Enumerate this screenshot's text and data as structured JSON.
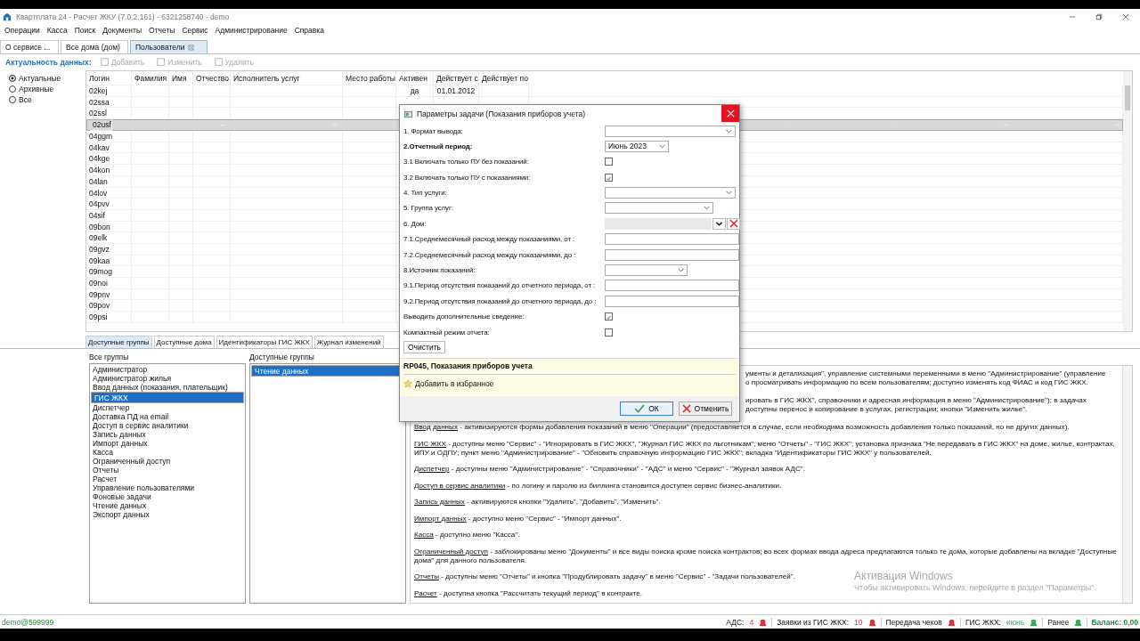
{
  "window": {
    "title": "Квартплата 24 - Расчет ЖКУ (7.0.2.161) - 6321258740 - demo"
  },
  "menu": [
    "Операции",
    "Касса",
    "Поиск",
    "Документы",
    "Отчеты",
    "Сервис",
    "Администрирование",
    "Справка"
  ],
  "tabs": [
    {
      "label": "О сервисе ...",
      "selected": false,
      "closable": false
    },
    {
      "label": "Все дома (дом)",
      "selected": false,
      "closable": false
    },
    {
      "label": "Пользователи",
      "selected": true,
      "closable": true
    }
  ],
  "toolbar": {
    "label": "Актуальность данных:",
    "buttons": [
      {
        "label": "Добавить",
        "disabled": true
      },
      {
        "label": "Изменить",
        "disabled": true
      },
      {
        "label": "Удалить",
        "disabled": true
      }
    ]
  },
  "filter": [
    {
      "label": "Актуальные",
      "selected": true
    },
    {
      "label": "Архивные",
      "selected": false
    },
    {
      "label": "Все",
      "selected": false
    }
  ],
  "table": {
    "columns": [
      "Логин",
      "Фамилия",
      "Имя",
      "Отчество",
      "Исполнитель услуг",
      "Место работы",
      "Активен",
      "Действует с",
      "Действует по"
    ],
    "rows": [
      {
        "login": "02kej",
        "active": "да",
        "from": "01.01.2012",
        "selected": false
      },
      {
        "login": "02ssa",
        "selected": false
      },
      {
        "login": "02ssl",
        "selected": false
      },
      {
        "login": "02usf",
        "selected": true
      },
      {
        "login": "04ggm",
        "selected": false
      },
      {
        "login": "04kav",
        "selected": false
      },
      {
        "login": "04kge",
        "selected": false
      },
      {
        "login": "04kon",
        "selected": false
      },
      {
        "login": "04lan",
        "selected": false
      },
      {
        "login": "04lov",
        "selected": false
      },
      {
        "login": "04pvv",
        "selected": false
      },
      {
        "login": "04sif",
        "selected": false
      },
      {
        "login": "09bon",
        "selected": false
      },
      {
        "login": "09elk",
        "selected": false
      },
      {
        "login": "09gvz",
        "selected": false
      },
      {
        "login": "09kaa",
        "selected": false
      },
      {
        "login": "09mog",
        "selected": false
      },
      {
        "login": "09noi",
        "selected": false
      },
      {
        "login": "09pnv",
        "selected": false
      },
      {
        "login": "09pov",
        "selected": false
      },
      {
        "login": "09psi",
        "selected": false
      }
    ]
  },
  "bottom_tabs": [
    {
      "label": "Доступные группы",
      "selected": true
    },
    {
      "label": "Доступные дома",
      "selected": false
    },
    {
      "label": "Идентификаторы ГИС ЖКХ",
      "selected": false
    },
    {
      "label": "Журнал изменений",
      "selected": false
    }
  ],
  "all_groups": {
    "title": "Все группы",
    "items": [
      {
        "label": "Администратор",
        "selected": false
      },
      {
        "label": "Администратор жилья",
        "selected": false
      },
      {
        "label": "Ввод данных (показания, плательщик)",
        "selected": false
      },
      {
        "label": "ГИС ЖКХ",
        "selected": true
      },
      {
        "label": "Диспетчер",
        "selected": false
      },
      {
        "label": "Доставка ПД на email",
        "selected": false
      },
      {
        "label": "Доступ в сервис аналитики",
        "selected": false
      },
      {
        "label": "Запись данных",
        "selected": false
      },
      {
        "label": "Импорт данных",
        "selected": false
      },
      {
        "label": "Касса",
        "selected": false
      },
      {
        "label": "Ограниченный доступ",
        "selected": false
      },
      {
        "label": "Отчеты",
        "selected": false
      },
      {
        "label": "Расчет",
        "selected": false
      },
      {
        "label": "Управление пользователями",
        "selected": false
      },
      {
        "label": "Фоновые задачи",
        "selected": false
      },
      {
        "label": "Чтение данных",
        "selected": false
      },
      {
        "label": "Экспорт данных",
        "selected": false
      }
    ]
  },
  "available_groups": {
    "title": "Доступные группы",
    "items": [
      {
        "label": "Чтение данных",
        "selected": true
      }
    ]
  },
  "description": [
    {
      "kind": "partial",
      "lines": [
        "ументы и детализация\", управление системными переменными в меню \"Администрирование\" (управление",
        "о просматривать информацию по всем пользователям; доступно изменять код ФИАС и код ГИС ЖКХ."
      ]
    },
    {
      "kind": "partial",
      "lines": [
        "ировать в ГИС ЖКХ\", справочники и адресная информация в меню \"Администрирование\"); в задачах",
        "доступны перенос и копирование в услугах, регистрации; кнопки \"Изменить жилье\"."
      ]
    },
    {
      "kind": "entry",
      "term": "Ввод данных",
      "text": " - активизируются формы добавления показаний в меню \"Операции\" (предоставляется в случае, если необходима возможность добавления только показаний, но не других данных)."
    },
    {
      "kind": "entry",
      "term": "ГИС ЖКХ",
      "text": " - доступны меню \"Сервис\" - \"Игнорировать в ГИС ЖКХ\", \"Журнал ГИС ЖКХ по льготникам\"; меню \"Отчеты\" - \"ГИС ЖКХ\"; установка признака \"Не передавать в ГИС ЖКХ\" на доме, жилье, контрактах, ИПУ и ОДПУ; пункт меню \"Администрирование\" - \"Обновить справочную информацию ГИС ЖКХ\"; вкладка \"Идентификаторы ГИС ЖКХ\" у пользователей."
    },
    {
      "kind": "entry",
      "term": "Диспетчер",
      "text": " - доступны меню \"Администрирование\" - \"Справочники\" - \"АДС\" и меню \"Сервис\" - \"Журнал заявок АДС\"."
    },
    {
      "kind": "entry",
      "term": "Доступ в сервис аналитики",
      "text": " - по логину и паролю из биллинга становится доступен сервис бизнес-аналитики."
    },
    {
      "kind": "entry",
      "term": "Запись данных",
      "text": " - активируются кнопки \"Удалить\", \"Добавить\", \"Изменить\"."
    },
    {
      "kind": "entry",
      "term": "Импорт данных",
      "text": " - доступно меню \"Сервис\" - \"Импорт данных\"."
    },
    {
      "kind": "entry",
      "term": "Касса",
      "text": " - доступно меню \"Касса\"."
    },
    {
      "kind": "entry",
      "term": "Ограниченный доступ",
      "text": " - заблокированы меню \"Документы\" и все виды поиска кроме поиска контрактов; во всех формах ввода адреса предлагаются только те дома, которые добавлены на вкладке \"Доступные дома\" для данного пользователя."
    },
    {
      "kind": "entry",
      "term": "Отчеты",
      "text": " - доступны меню \"Отчеты\" и кнопка \"Продублировать задачу\" в меню \"Сервис\" - \"Задачи пользователей\"."
    },
    {
      "kind": "entry",
      "term": "Расчет",
      "text": " - доступна кнопка \"Рассчитать текущий период\" в контракте."
    }
  ],
  "activation": {
    "title": "Активация Windows",
    "text": "Чтобы активировать Windows, перейдите в раздел \"Параметры\"."
  },
  "dialog": {
    "title": "Параметры задачи (Показания приборов учета)",
    "fields": [
      {
        "kind": "select",
        "label": "1. Формат вывода:",
        "required": false
      },
      {
        "kind": "select",
        "label": "2.Отчетный период:",
        "value": "Июнь 2023",
        "required": true
      },
      {
        "kind": "checkbox",
        "label": "3.1 Включать только ПУ без показаний:",
        "checked": false,
        "required": false
      },
      {
        "kind": "checkbox",
        "label": "3.2 Включать только ПУ с показаниями:",
        "checked": true,
        "required": false
      },
      {
        "kind": "select",
        "label": "4. Тип услуги:",
        "required": false
      },
      {
        "kind": "select",
        "label": "5. Группа услуг:",
        "required": false
      },
      {
        "kind": "picker",
        "label": "6. Дом:",
        "required": false
      },
      {
        "kind": "input",
        "label": "7.1.Среднемесячный расход между показаниями, от :",
        "required": false
      },
      {
        "kind": "input",
        "label": "7.2.Среднемесячный расход между показаниями, до :",
        "required": false
      },
      {
        "kind": "select",
        "label": "8.Источник показаний:",
        "required": false
      },
      {
        "kind": "input",
        "label": "9.1.Период отсутствия показаний до отчетного периода, от :",
        "required": false
      },
      {
        "kind": "input",
        "label": "9.2.Период отсутствия показаний до отчетного периода, до :",
        "required": false
      },
      {
        "kind": "checkbox",
        "label": "Выводить дополнительные сведение:",
        "checked": true,
        "required": false
      },
      {
        "kind": "checkbox",
        "label": "Компактный режим отчета:",
        "checked": false,
        "required": false
      }
    ],
    "clear_button": "Очистить",
    "report": "RP045, Показания приборов учета",
    "favorite": "Добавить в избранное",
    "ok": "ОК",
    "cancel": "Отменить"
  },
  "status_bar": {
    "user": "demo@599999",
    "items": [
      {
        "label": "АДС:",
        "value": "4",
        "color": "#d9343a"
      },
      {
        "label": "Заявки из ГИС ЖКХ:",
        "value": "10",
        "color": "#d9343a"
      },
      {
        "label": "Передача чеков",
        "color": "#d9343a"
      },
      {
        "label": "ГИС ЖКХ:",
        "value": "июнь",
        "color": "#3aa85a"
      },
      {
        "label": "Ранее",
        "color": "#3aa85a"
      }
    ],
    "balance": "Баланс: 0,00"
  }
}
